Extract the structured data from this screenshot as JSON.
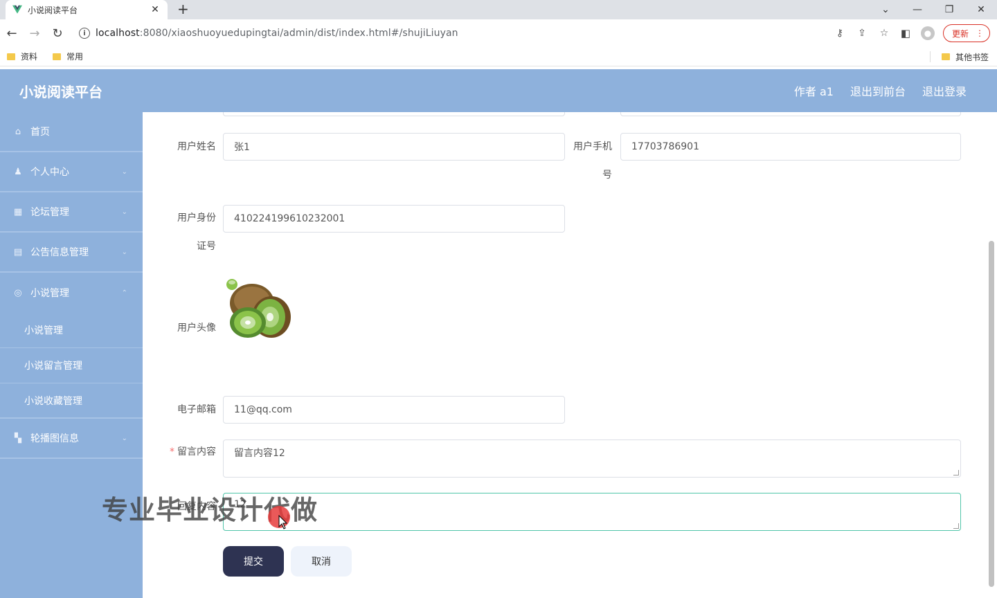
{
  "browser": {
    "tab_title": "小说阅读平台",
    "tab_close": "✕",
    "new_tab": "+",
    "url_host": "localhost",
    "url_path": ":8080/xiaoshuoyuedupingtai/admin/dist/index.html#/shujiLiuyan",
    "update_label": "更新",
    "bookmarks": [
      "资料",
      "常用"
    ],
    "other_bookmarks": "其他书签"
  },
  "header": {
    "title": "小说阅读平台",
    "user": "作者 a1",
    "to_front": "退出到前台",
    "logout": "退出登录"
  },
  "sidebar": {
    "items": [
      {
        "label": "首页",
        "icon": "home-icon"
      },
      {
        "label": "个人中心",
        "icon": "user-icon"
      },
      {
        "label": "论坛管理",
        "icon": "forum-icon"
      },
      {
        "label": "公告信息管理",
        "icon": "notice-icon"
      },
      {
        "label": "小说管理",
        "icon": "book-icon"
      }
    ],
    "sub_items": [
      "小说管理",
      "小说留言管理",
      "小说收藏管理"
    ],
    "last_item": {
      "label": "轮播图信息",
      "icon": "grid-icon"
    }
  },
  "form": {
    "name_label": "用户姓名",
    "name_value": "张1",
    "phone_label_1": "用户手机",
    "phone_label_2": "号",
    "phone_value": "17703786901",
    "id_label_1": "用户身份",
    "id_label_2": "证号",
    "id_value": "410224199610232001",
    "avatar_label": "用户头像",
    "email_label": "电子邮箱",
    "email_value": "11@qq.com",
    "required_mark": "*",
    "message_label": "留言内容",
    "message_value": "留言内容12",
    "reply_label": "回复内容",
    "reply_value": "12",
    "submit": "提交",
    "cancel": "取消"
  },
  "overlay": {
    "watermark": "专业毕业设计代做"
  }
}
